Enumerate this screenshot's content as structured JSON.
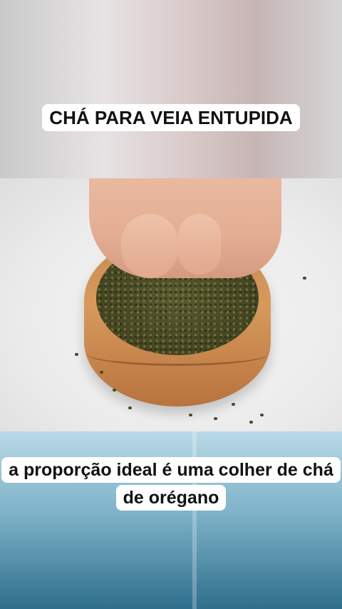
{
  "captions": {
    "top": "CHÁ PARA VEIA ENTUPIDA",
    "bottom": "a proporção ideal é uma colher de chá de orégano"
  }
}
